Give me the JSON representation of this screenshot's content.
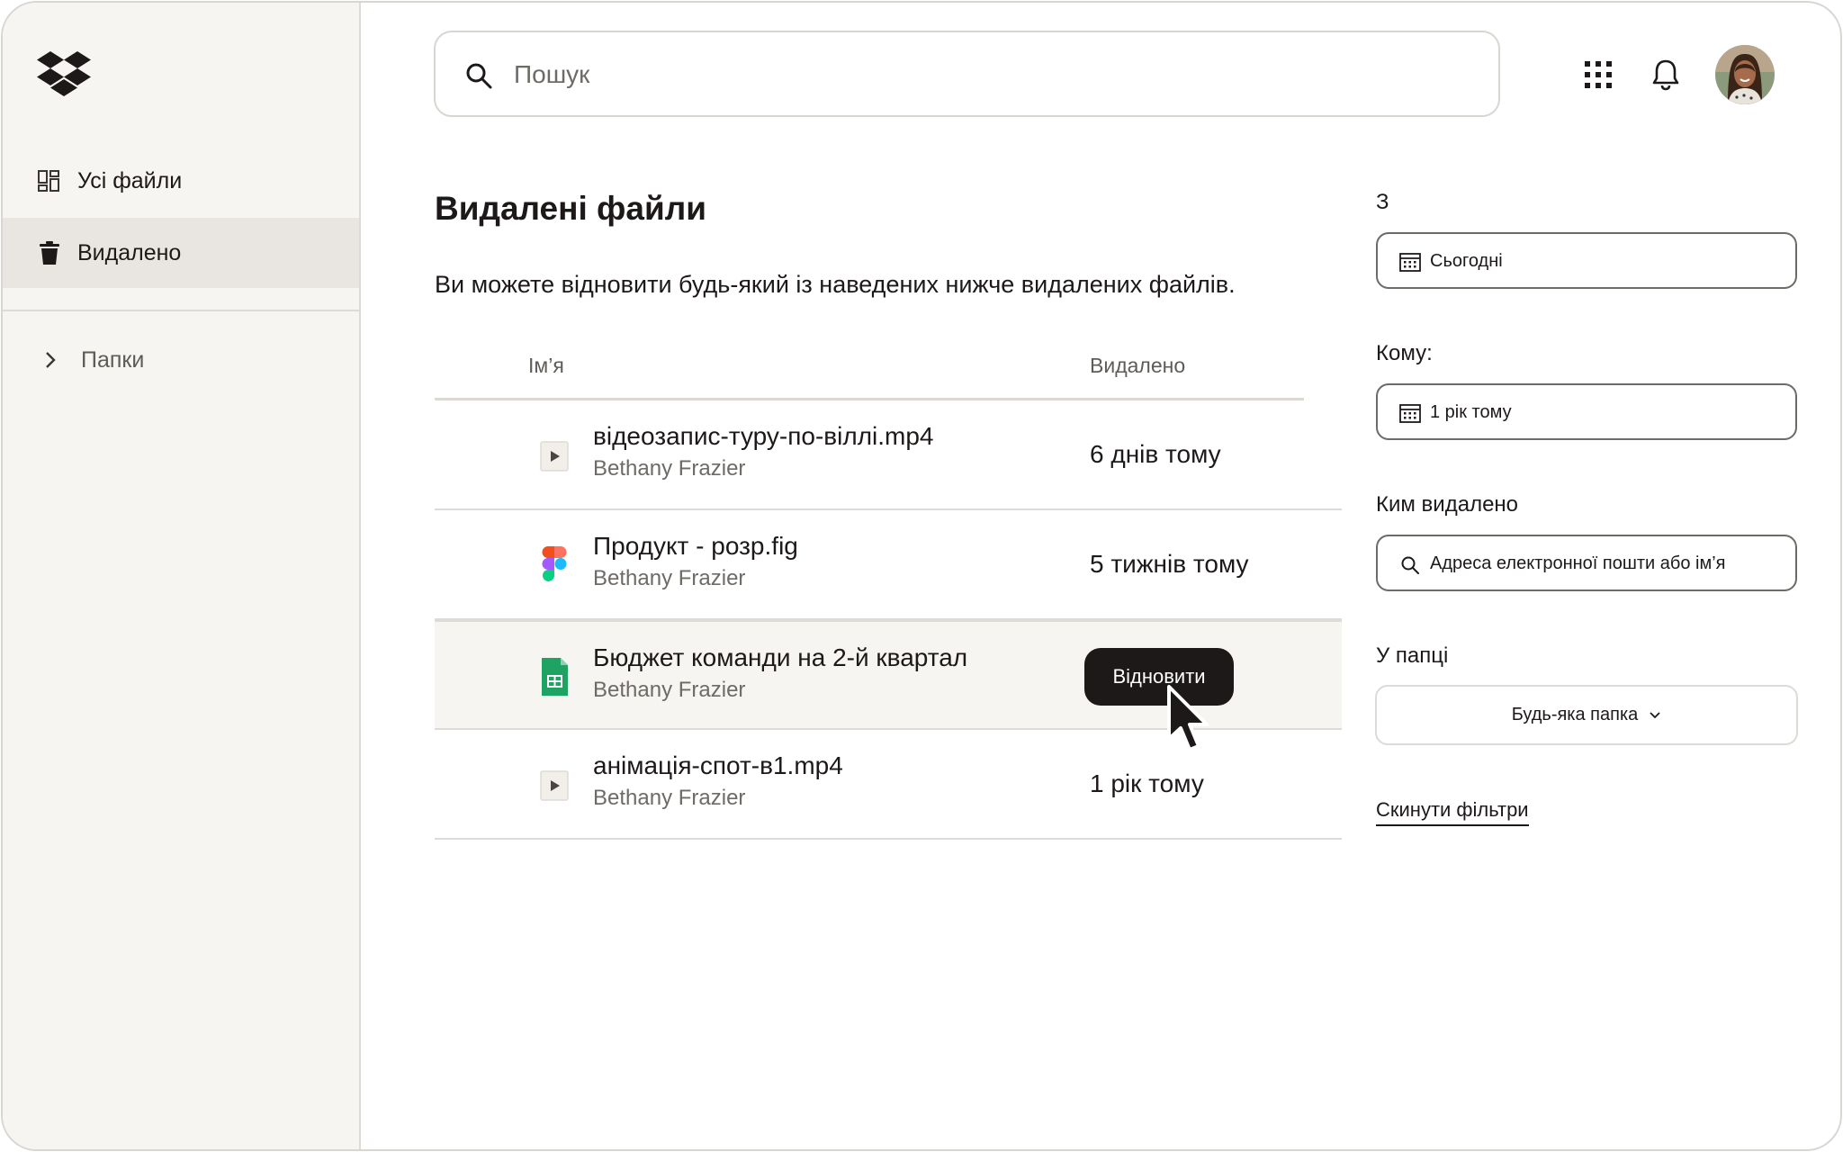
{
  "sidebar": {
    "items": [
      {
        "label": "Усі файли"
      },
      {
        "label": "Видалено"
      },
      {
        "label": "Папки"
      }
    ]
  },
  "search": {
    "placeholder": "Пошук"
  },
  "main": {
    "title": "Видалені файли",
    "subtitle": "Ви можете відновити будь-який із наведених нижче видалених файлів.",
    "columns": {
      "name": "Ім’я",
      "deleted": "Видалено"
    },
    "rows": [
      {
        "name": "відеозапис-туру-по-віллі.mp4",
        "owner": "Bethany Frazier",
        "deleted": "6 днів тому",
        "icon": "video-file-icon"
      },
      {
        "name": "Продукт - розр.fig",
        "owner": "Bethany Frazier",
        "deleted": "5 тижнів тому",
        "icon": "figma-file-icon"
      },
      {
        "name": "Бюджет команди на 2-й квартал",
        "owner": "Bethany Frazier",
        "deleted": "",
        "icon": "spreadsheet-file-icon",
        "action": "Відновити"
      },
      {
        "name": "анімація-спот-в1.mp4",
        "owner": "Bethany Frazier",
        "deleted": "1 рік тому",
        "icon": "video-file-icon"
      }
    ]
  },
  "filters": {
    "from": {
      "label": "З",
      "value": "Сьогодні"
    },
    "to": {
      "label": "Кому:",
      "value": "1 рік тому"
    },
    "deleted_by": {
      "label": "Ким видалено",
      "placeholder": "Адреса електронної пошти або ім’я"
    },
    "folder": {
      "label": "У папці",
      "value": "Будь-яка папка"
    },
    "reset": "Скинути фільтри"
  },
  "colors": {
    "sidebar_bg": "#f7f5f2",
    "selected_bg": "#e9e6e2",
    "primary_text": "#1e1919",
    "button_bg": "#1e1919",
    "sheets_green": "#1ea362"
  }
}
